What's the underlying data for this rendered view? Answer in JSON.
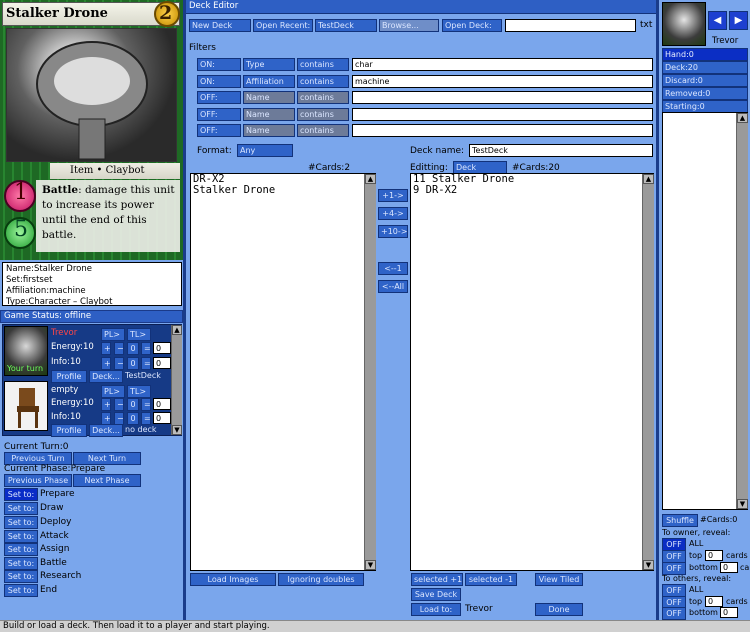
{
  "card": {
    "name": "Stalker Drone",
    "cost": "2",
    "type_line": "Item • Claybot",
    "stat1": "1",
    "stat2": "5",
    "ability_name": "Battle",
    "ability_text": ": damage this unit to increase its power until the end of this battle."
  },
  "card_info": {
    "name": "Name:Stalker Drone",
    "set": "Set:firstset",
    "affiliation": "Affiliation:machine",
    "type": "Type:Character – Claybot"
  },
  "game_status": {
    "title": "Game Status: offline"
  },
  "players": [
    {
      "name": "Trevor",
      "pl": "PL>",
      "tl": "TL>",
      "energy_label": "Energy:10",
      "info_label": "Info:10",
      "energy_val": "0",
      "energy_total": "0",
      "info_val": "0",
      "info_total": "0",
      "profile": "Profile",
      "deck_btn": "Deck...",
      "deck_name": "TestDeck",
      "turn_label": "Your turn"
    },
    {
      "name": "empty",
      "pl": "PL>",
      "tl": "TL>",
      "energy_label": "Energy:10",
      "info_label": "Info:10",
      "energy_val": "0",
      "energy_total": "0",
      "info_val": "0",
      "info_total": "0",
      "profile": "Profile",
      "deck_btn": "Deck...",
      "deck_name": "no deck"
    }
  ],
  "turn": {
    "current_turn": "Current Turn:0",
    "prev_turn": "Previous Turn",
    "next_turn": "Next Turn",
    "current_phase": "Current Phase:Prepare",
    "prev_phase": "Previous Phase",
    "next_phase": "Next Phase",
    "set_to": "Set to:",
    "phases": [
      "Prepare",
      "Draw",
      "Deploy",
      "Attack",
      "Assign",
      "Battle",
      "Research",
      "End"
    ]
  },
  "editor": {
    "title": "Deck Editor",
    "new_deck": "New Deck",
    "open_recent": "Open Recent:",
    "recent_value": "TestDeck",
    "browse": "Browse...",
    "open_deck": "Open Deck:",
    "open_deck_value": "",
    "ext": "txt",
    "filters_label": "Filters",
    "filters": [
      {
        "state": "ON:",
        "field": "Type",
        "op": "contains",
        "value": "char"
      },
      {
        "state": "ON:",
        "field": "Affiliation",
        "op": "contains",
        "value": "machine"
      },
      {
        "state": "OFF:",
        "field": "Name",
        "op": "contains",
        "value": ""
      },
      {
        "state": "OFF:",
        "field": "Name",
        "op": "contains",
        "value": ""
      },
      {
        "state": "OFF:",
        "field": "Name",
        "op": "contains",
        "value": ""
      }
    ],
    "format_label": "Format:",
    "format_value": "Any",
    "deck_name_label": "Deck name:",
    "deck_name_value": "TestDeck",
    "left_count": "#Cards:2",
    "editing_label": "Editting:",
    "editing_value": "Deck",
    "right_count": "#Cards:20",
    "left_list": [
      "DR-X2",
      "Stalker Drone"
    ],
    "right_list": [
      "11 Stalker Drone",
      "9 DR-X2"
    ],
    "add_buttons": [
      "+1->",
      "+4->",
      "+10->"
    ],
    "remove_buttons": [
      "<--1",
      "<--All"
    ],
    "load_images": "Load Images",
    "ignoring_doubles": "Ignoring doubles",
    "selected_plus": "selected +1",
    "selected_minus": "selected -1",
    "view_tiled": "View Tiled",
    "save_deck": "Save Deck",
    "load_to": "Load to:",
    "load_to_value": "Trevor",
    "done": "Done"
  },
  "right_panel": {
    "player": "Trevor",
    "zones": [
      "Hand:0",
      "Deck:20",
      "Discard:0",
      "Removed:0",
      "Starting:0"
    ],
    "shuffle": "Shuffle",
    "cards_count": "#Cards:0",
    "owner_reveal": "To owner, reveal:",
    "others_reveal": "To others, reveal:",
    "off": "OFF",
    "all": "ALL",
    "top": "top",
    "bottom": "bottom",
    "cards": "cards",
    "zero": "0"
  },
  "status_bar": "Build or load a deck. Then load it to a player and start playing."
}
